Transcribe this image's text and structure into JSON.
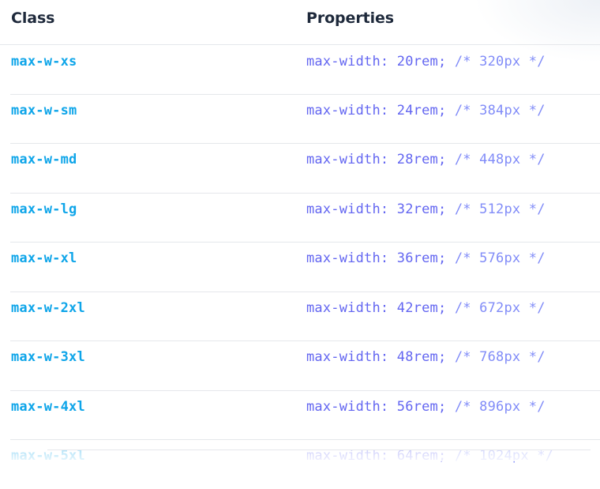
{
  "header": {
    "class_label": "Class",
    "properties_label": "Properties"
  },
  "rows": [
    {
      "class": "max-w-xs",
      "property": "max-width: 20rem;",
      "comment": "/* 320px */"
    },
    {
      "class": "max-w-sm",
      "property": "max-width: 24rem;",
      "comment": "/* 384px */"
    },
    {
      "class": "max-w-md",
      "property": "max-width: 28rem;",
      "comment": "/* 448px */"
    },
    {
      "class": "max-w-lg",
      "property": "max-width: 32rem;",
      "comment": "/* 512px */"
    },
    {
      "class": "max-w-xl",
      "property": "max-width: 36rem;",
      "comment": "/* 576px */"
    },
    {
      "class": "max-w-2xl",
      "property": "max-width: 42rem;",
      "comment": "/* 672px */"
    },
    {
      "class": "max-w-3xl",
      "property": "max-width: 48rem;",
      "comment": "/* 768px */"
    },
    {
      "class": "max-w-4xl",
      "property": "max-width: 56rem;",
      "comment": "/* 896px */"
    },
    {
      "class": "max-w-5xl",
      "property": "max-width: 64rem;",
      "comment": "/* 1024px */"
    }
  ]
}
